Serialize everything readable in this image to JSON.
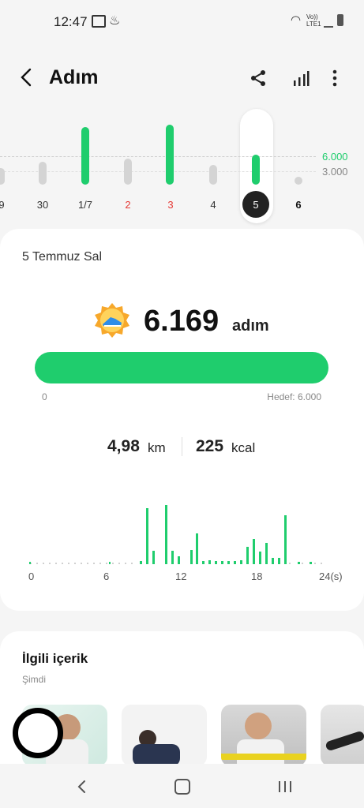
{
  "status": {
    "time": "12:47",
    "network": "Vo)) LTE1"
  },
  "header": {
    "title": "Adım"
  },
  "week": {
    "labels": [
      "9",
      "30",
      "1/7",
      "2",
      "3",
      "4",
      "5",
      "6"
    ],
    "goal_label": "6.000",
    "mid_label": "3.000",
    "selected": "5",
    "colors": {
      "goal": "#1fcd6d",
      "normal": "#333333",
      "weekend": "#e53935"
    }
  },
  "summary": {
    "date": "5 Temmuz Sal",
    "steps": "6.169",
    "unit": "adım",
    "progress_percent": 100,
    "start_label": "0",
    "goal_label": "Hedef: 6.000",
    "distance_value": "4,98",
    "distance_unit": "km",
    "calories_value": "225",
    "calories_unit": "kcal"
  },
  "chart_data": {
    "type": "bar",
    "x_ticks": [
      "0",
      "6",
      "12",
      "18",
      "24(s)"
    ]
  },
  "related": {
    "title": "İlgili içerik",
    "subtitle": "Şimdi"
  }
}
